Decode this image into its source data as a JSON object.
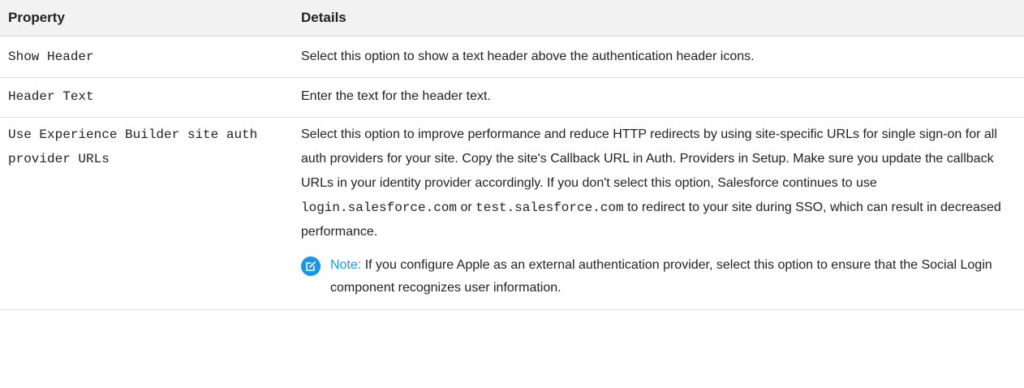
{
  "table": {
    "headers": {
      "property": "Property",
      "details": "Details"
    },
    "rows": [
      {
        "property": "Show Header",
        "details": "Select this option to show a text header above the authentication header icons."
      },
      {
        "property": "Header Text",
        "details": "Enter the text for the header text."
      },
      {
        "property": "Use Experience Builder site auth provider URLs",
        "details_intro": "Select this option to improve performance and reduce HTTP redirects by using site-specific URLs for single sign-on for all auth providers for your site. Copy the site's Callback URL in Auth. Providers in Setup. Make sure you update the callback URLs in your identity provider accordingly. If you don't select this option, Salesforce continues to use",
        "code_1": "login.salesforce.com",
        "connector": "or",
        "code_2": "test.salesforce.com",
        "details_outro": "to redirect to your site during SSO, which can result in decreased performance.",
        "note_label": "Note:",
        "note_text": "If you configure Apple as an external authentication provider, select this option to ensure that the Social Login component recognizes user information."
      }
    ]
  },
  "colors": {
    "header_bg": "#f2f2f2",
    "note_accent": "#1b96e6",
    "text": "#222222"
  },
  "icons": {
    "note": "edit-note-icon"
  }
}
